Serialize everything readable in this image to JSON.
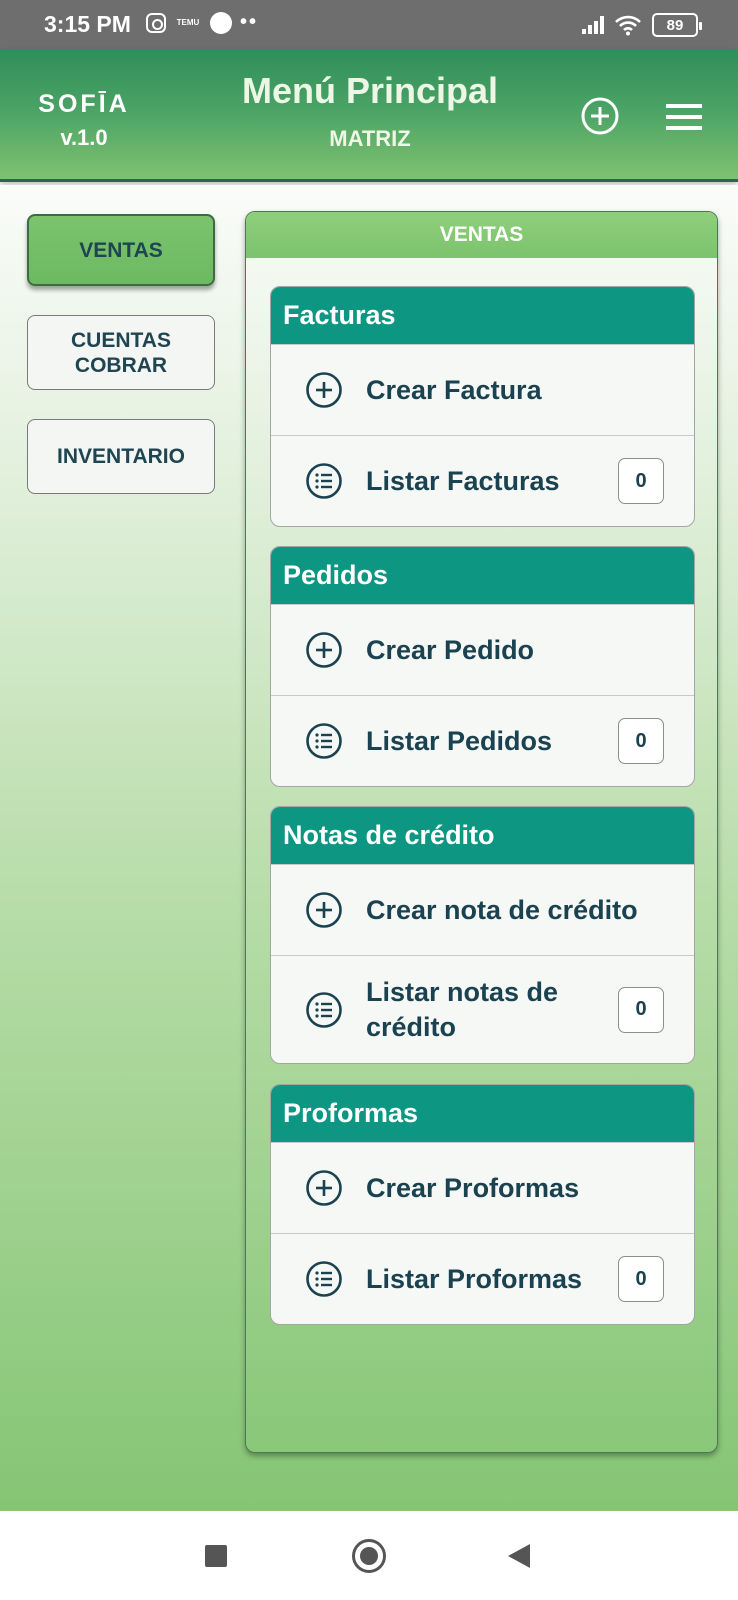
{
  "status_bar": {
    "time": "3:15 PM",
    "temu_label": "TEMU",
    "dots": "••",
    "battery": "89",
    "icons": [
      "instagram-icon",
      "temu-icon",
      "app-ball-icon",
      "signal-icon",
      "wifi-icon",
      "battery-icon"
    ]
  },
  "header": {
    "logo_name": "SOFĪA",
    "version": "v.1.0",
    "title": "Menú Principal",
    "subtitle": "MATRIZ",
    "icons": [
      "add-circle-icon",
      "hamburger-menu-icon"
    ]
  },
  "sidebar": {
    "items": [
      {
        "label": "VENTAS",
        "active": true
      },
      {
        "label": "CUENTAS COBRAR",
        "active": false
      },
      {
        "label": "INVENTARIO",
        "active": false
      }
    ]
  },
  "panel": {
    "title": "VENTAS",
    "sections": [
      {
        "title": "Facturas",
        "create_label": "Crear Factura",
        "list_label": "Listar Facturas",
        "count": "0"
      },
      {
        "title": "Pedidos",
        "create_label": "Crear Pedido",
        "list_label": "Listar Pedidos",
        "count": "0"
      },
      {
        "title": "Notas de crédito",
        "create_label": "Crear nota de crédito",
        "list_label": "Listar notas de crédito",
        "count": "0"
      },
      {
        "title": "Proformas",
        "create_label": "Crear Proformas",
        "list_label": "Listar Proformas",
        "count": "0"
      }
    ]
  },
  "colors": {
    "header_green": "#4aa265",
    "card_header_teal": "#0d9682",
    "active_tab_green": "#7cc36e",
    "text_dark": "#1b4250"
  },
  "nav_bar": {
    "icons": [
      "recents-square-icon",
      "home-circle-icon",
      "back-triangle-icon"
    ]
  }
}
